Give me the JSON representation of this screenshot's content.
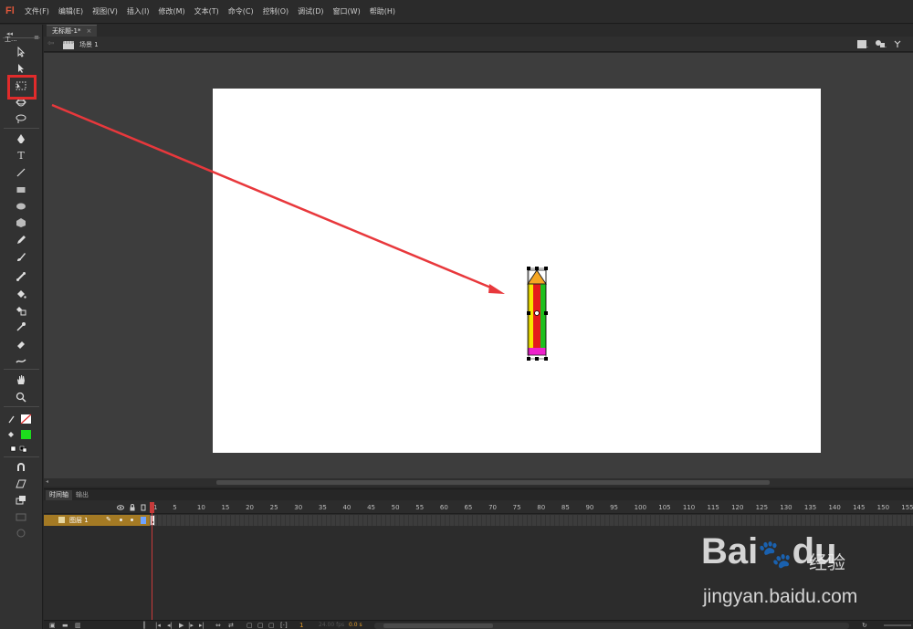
{
  "app": {
    "logo": "Fl",
    "menu": [
      "文件(F)",
      "编辑(E)",
      "视图(V)",
      "插入(I)",
      "修改(M)",
      "文本(T)",
      "命令(C)",
      "控制(O)",
      "调试(D)",
      "窗口(W)",
      "帮助(H)"
    ]
  },
  "toolbar": {
    "label": "工...",
    "menu_glyph": "≡",
    "collapse_glyph": "◂◂",
    "selected_tool": "free-transform-tool",
    "tools": [
      "selection-tool",
      "subselection-tool",
      "free-transform-tool",
      "3d-rotation-tool",
      "lasso-tool",
      "pen-tool",
      "text-tool",
      "line-tool",
      "rectangle-tool",
      "oval-tool",
      "polystar-tool",
      "pencil-tool",
      "brush-tool",
      "bone-tool",
      "paint-bucket-tool",
      "ink-bottle-tool",
      "eyedropper-tool",
      "eraser-tool",
      "width-tool",
      "hand-tool",
      "zoom-tool",
      "stroke-color",
      "fill-color",
      "swap-colors",
      "snap-to-objects",
      "smooth",
      "straighten",
      "option-4"
    ],
    "text_tool_glyph": "T",
    "stroke_color": "none",
    "fill_color": "#1ddc1d"
  },
  "document": {
    "tab_title": "无标题-1*",
    "tab_close": "×",
    "scene_label": "场景 1",
    "stage_color": "#ffffff"
  },
  "pencil": {
    "tip_color": "#f5a623",
    "body_colors": [
      "#f7e600",
      "#e41b1b",
      "#1ec01e"
    ],
    "eraser_color": "#ee22cc",
    "outline_color": "#222222"
  },
  "annotation": {
    "highlight_color": "#e02b2b",
    "arrow_color": "#e8383c"
  },
  "timeline": {
    "tabs": [
      "时间轴",
      "输出"
    ],
    "frame_numbers": [
      "1",
      "5",
      "10",
      "15",
      "20",
      "25",
      "30",
      "35",
      "40",
      "45",
      "50",
      "55",
      "60",
      "65",
      "70",
      "75",
      "80",
      "85",
      "90",
      "95",
      "100",
      "105",
      "110",
      "115",
      "120",
      "125",
      "130",
      "135",
      "140",
      "145",
      "150",
      "155"
    ],
    "layer": {
      "name": "图层 1",
      "color": "#6fa3ff",
      "row_color": "#a47a24"
    },
    "current_frame": "1",
    "fps": "24.00 fps",
    "time": "0.0 s"
  },
  "watermark": {
    "brand": "Bai",
    "brand2": "du",
    "sub": "经验",
    "url": "jingyan.baidu.com"
  }
}
